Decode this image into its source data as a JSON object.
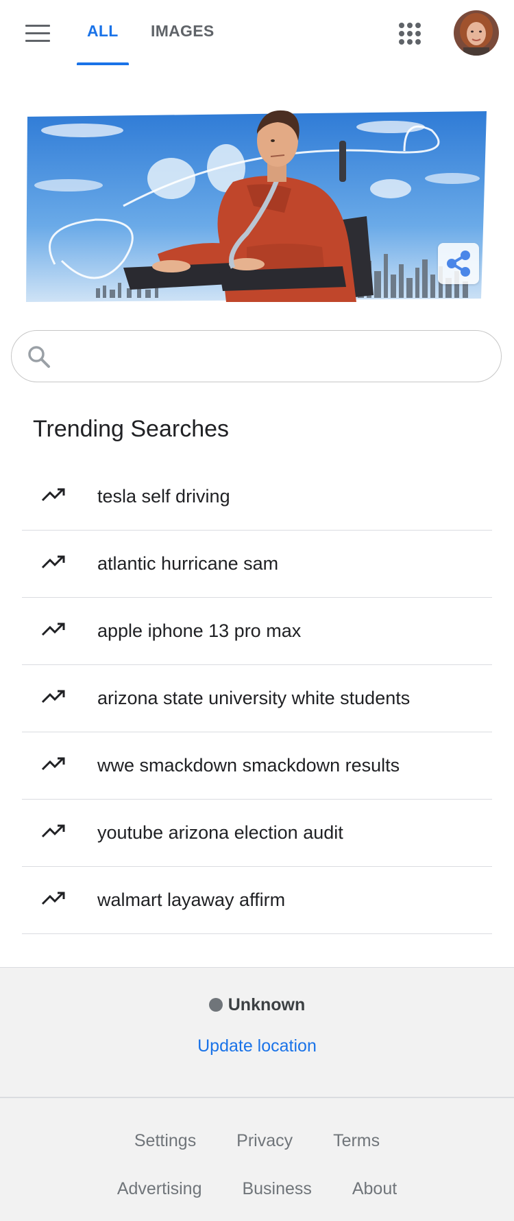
{
  "header": {
    "menu_icon": "hamburger-menu-icon",
    "tabs": [
      {
        "label": "ALL",
        "active": true
      },
      {
        "label": "IMAGES",
        "active": false
      }
    ],
    "apps_icon": "apps-grid-icon",
    "avatar": "user-avatar"
  },
  "doodle": {
    "share_icon": "share-icon"
  },
  "search": {
    "icon": "search-icon",
    "value": "",
    "placeholder": ""
  },
  "trending": {
    "title": "Trending Searches",
    "icon": "trending-up-icon",
    "items": [
      {
        "label": "tesla self driving"
      },
      {
        "label": "atlantic hurricane sam"
      },
      {
        "label": "apple iphone 13 pro max"
      },
      {
        "label": "arizona state university white students"
      },
      {
        "label": "wwe smackdown smackdown results"
      },
      {
        "label": "youtube arizona election audit"
      },
      {
        "label": "walmart layaway affirm"
      }
    ]
  },
  "footer": {
    "location": "Unknown",
    "update_location": "Update location",
    "links_row1": [
      "Settings",
      "Privacy",
      "Terms"
    ],
    "links_row2": [
      "Advertising",
      "Business",
      "About"
    ]
  },
  "colors": {
    "accent": "#1a73e8",
    "icon_gray": "#5f6368",
    "divider": "#dadce0",
    "footer_bg": "#f2f2f2"
  }
}
